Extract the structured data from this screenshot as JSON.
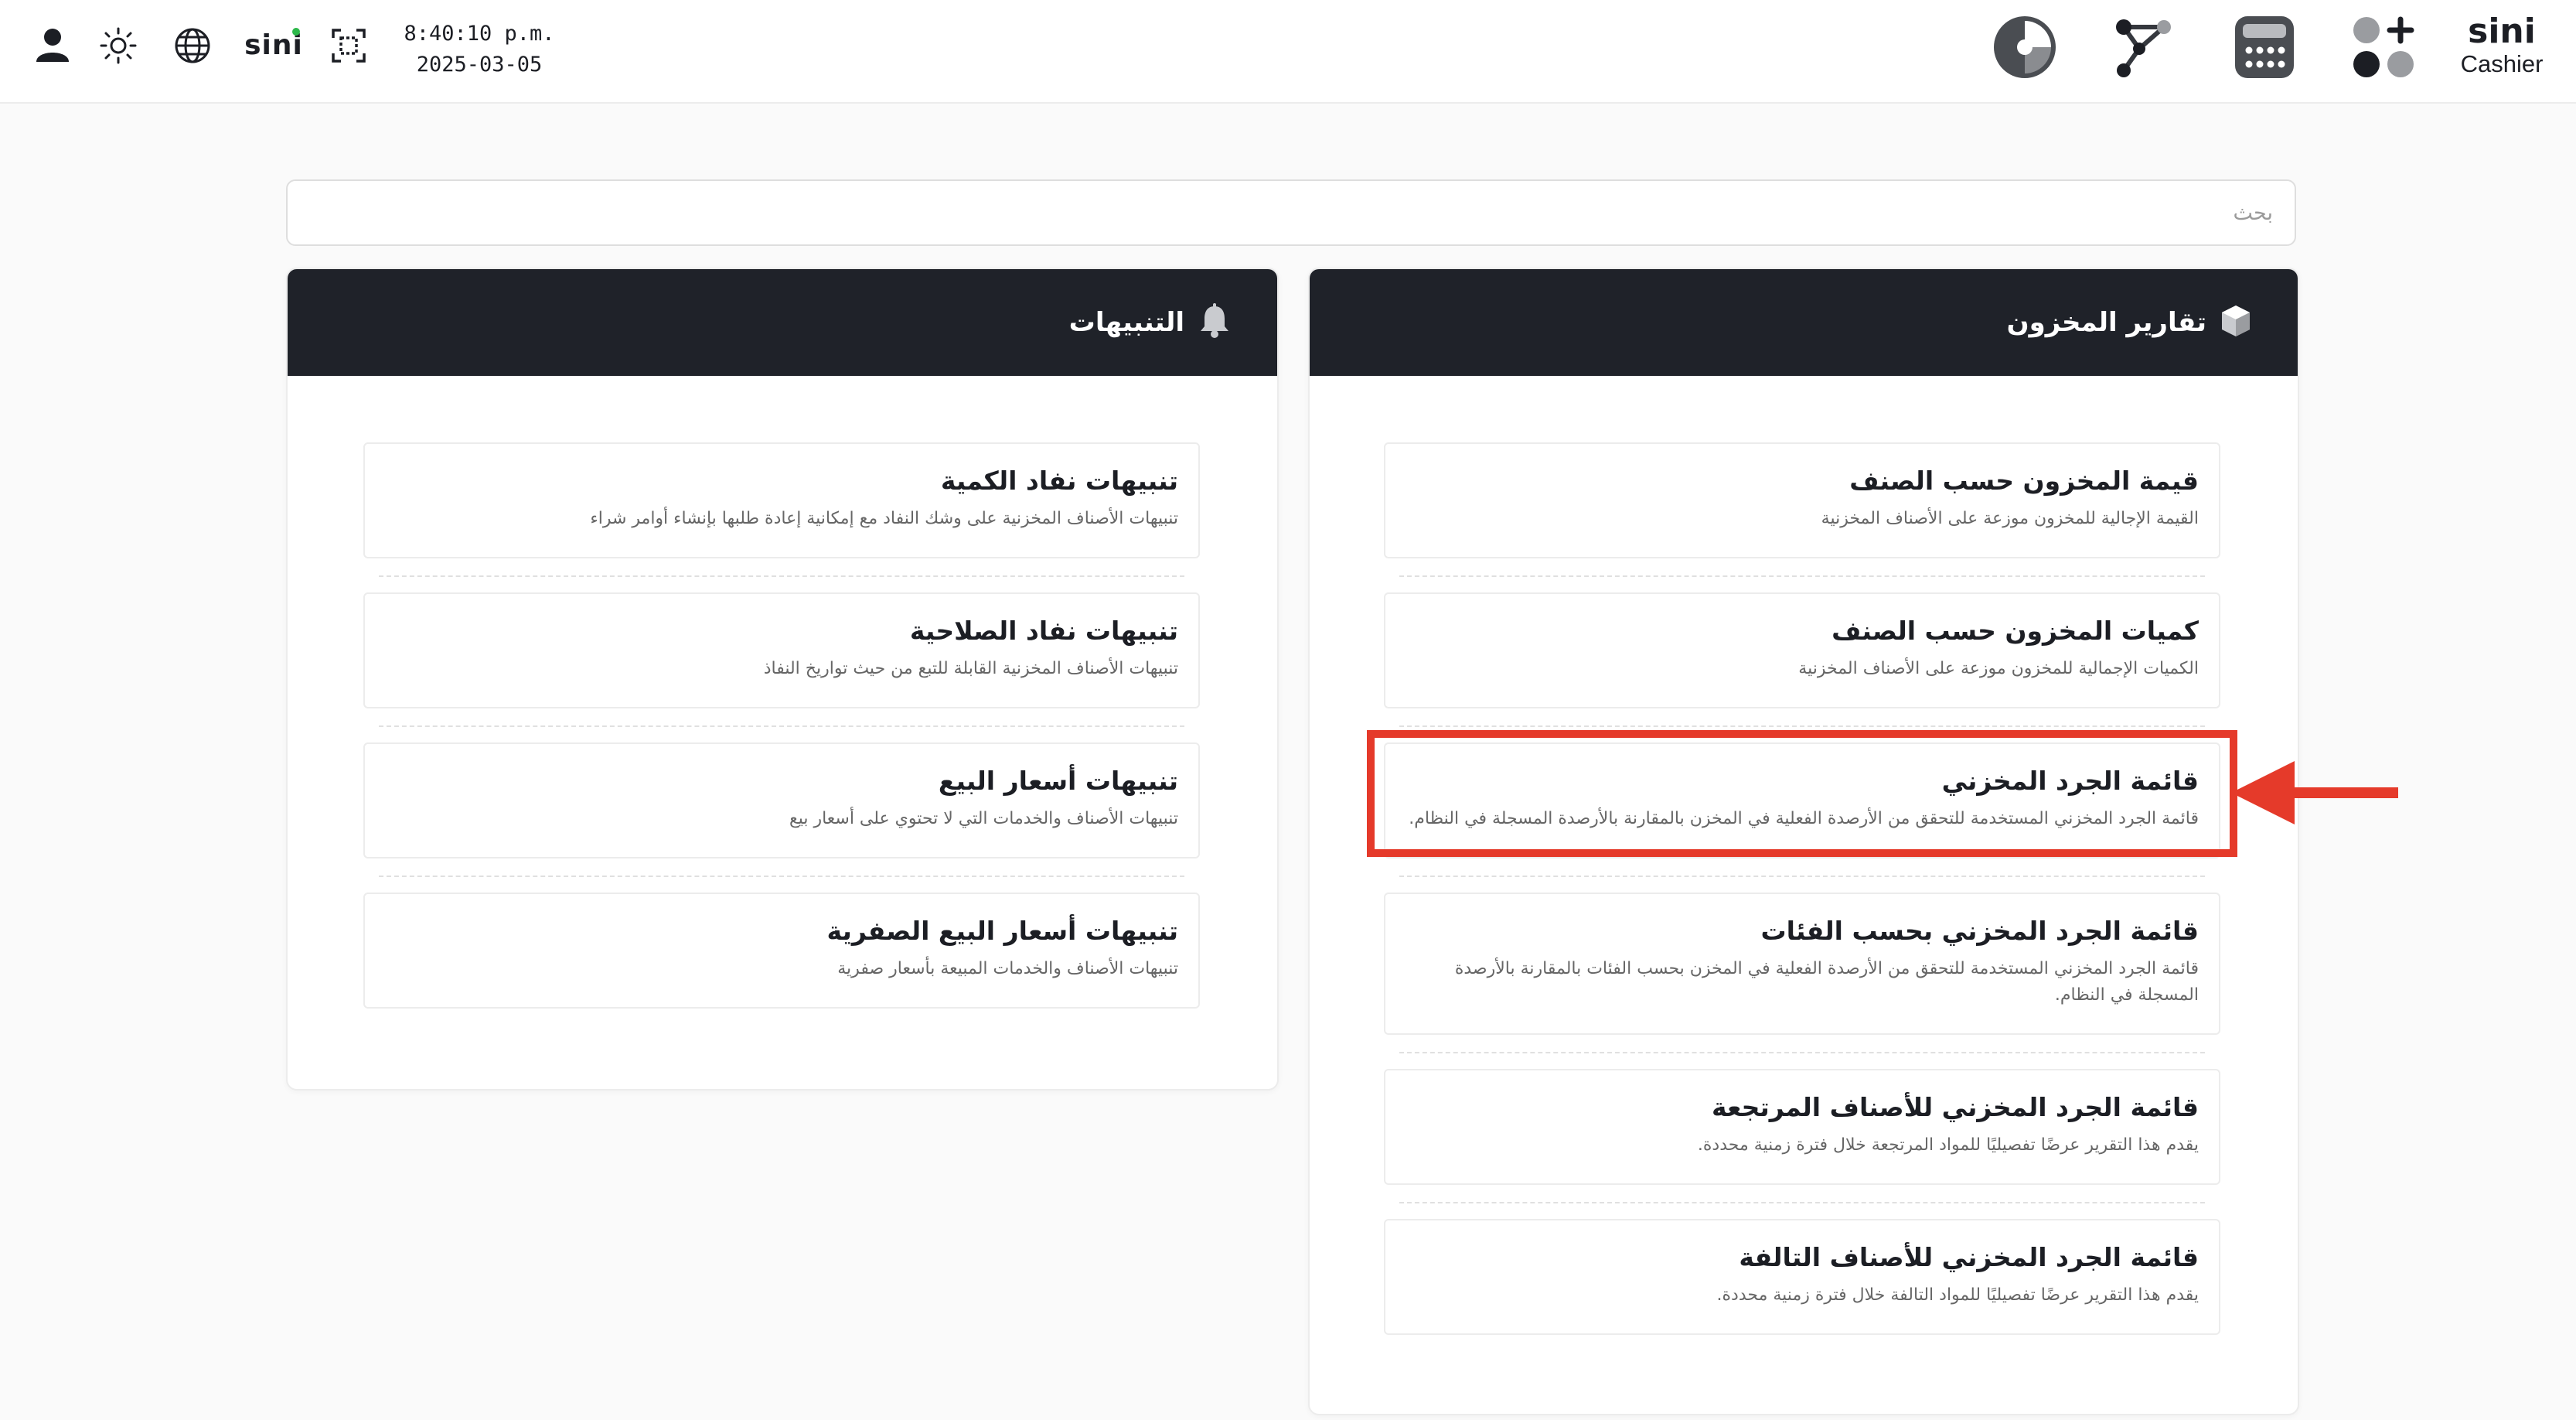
{
  "topbar": {
    "time": "8:40:10 p.m.",
    "date": "2025-03-05",
    "sini_small": "sini",
    "brand_logo": "sini",
    "brand_sub": "Cashier",
    "left_icons": [
      "user-icon",
      "sun-icon",
      "globe-icon",
      "sini-logo",
      "scan-icon"
    ],
    "right_icons": [
      "pie-chart-icon",
      "network-icon",
      "calculator-icon",
      "apps-icon"
    ]
  },
  "search": {
    "placeholder": "بحث",
    "value": ""
  },
  "inventory_reports": {
    "title": "تقارير المخزون",
    "icon": "box-icon",
    "items": [
      {
        "title": "قيمة المخزون حسب الصنف",
        "desc": "القيمة الإجالية للمخزون موزعة على الأصناف المخزنية"
      },
      {
        "title": "كميات المخزون حسب الصنف",
        "desc": "الكميات الإجمالية للمخزون موزعة على الأصناف المخزنية"
      },
      {
        "title": "قائمة الجرد المخزني",
        "desc": "قائمة الجرد المخزني المستخدمة للتحقق من الأرصدة الفعلية في المخزن بالمقارنة بالأرصدة المسجلة في النظام."
      },
      {
        "title": "قائمة الجرد المخزني بحسب الفئات",
        "desc": "قائمة الجرد المخزني المستخدمة للتحقق من الأرصدة الفعلية في المخزن بحسب الفئات بالمقارنة بالأرصدة المسجلة في النظام."
      },
      {
        "title": "قائمة الجرد المخزني للأصناف المرتجعة",
        "desc": "يقدم هذا التقرير عرضًا تفصيليًا للمواد المرتجعة خلال فترة زمنية محددة."
      },
      {
        "title": "قائمة الجرد المخزني للأصناف التالفة",
        "desc": "يقدم هذا التقرير عرضًا تفصيليًا للمواد التالفة خلال فترة زمنية محددة."
      }
    ]
  },
  "alerts": {
    "title": "التنبيهات",
    "icon": "bell-icon",
    "items": [
      {
        "title": "تنبيهات نفاد الكمية",
        "desc": "تنبيهات الأصناف المخزنية على وشك النفاد مع إمكانية إعادة طلبها بإنشاء أوامر شراء"
      },
      {
        "title": "تنبيهات نفاد الصلاحية",
        "desc": "تنبيهات الأصناف المخزنية القابلة للتبع من حيث تواريخ النفاذ"
      },
      {
        "title": "تنبيهات أسعار البيع",
        "desc": "تنبيهات الأصناف والخدمات التي لا تحتوي على أسعار بيع"
      },
      {
        "title": "تنبيهات أسعار البيع الصفرية",
        "desc": "تنبيهات الأصناف والخدمات المبيعة بأسعار صفرية"
      }
    ]
  },
  "colors": {
    "header_dark": "#1f2229",
    "highlight_red": "#e53a2a",
    "accent_green": "#2db84a"
  }
}
